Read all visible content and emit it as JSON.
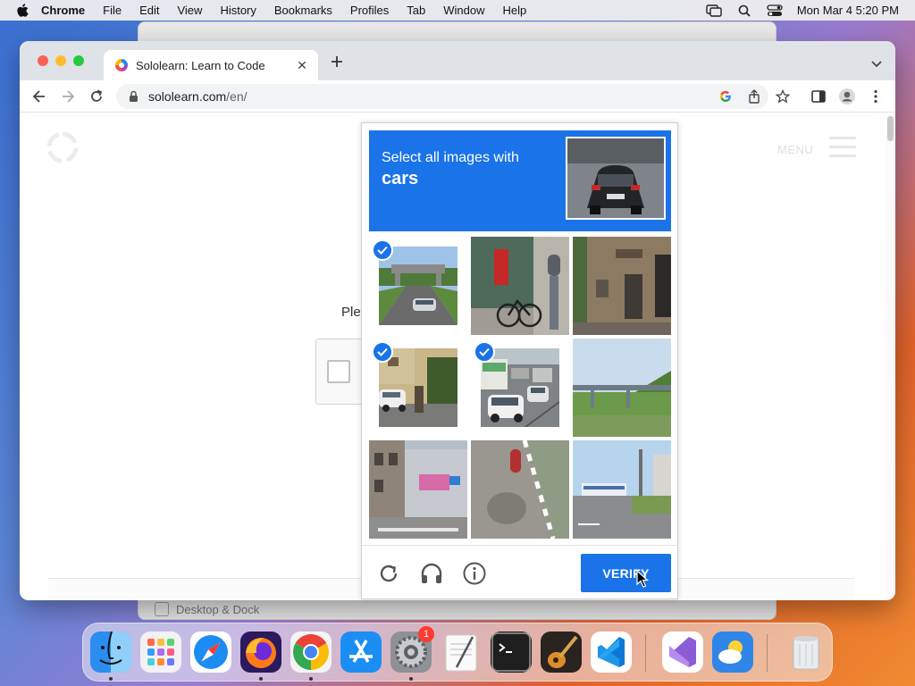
{
  "menubar": {
    "app_name": "Chrome",
    "items": [
      "File",
      "Edit",
      "View",
      "History",
      "Bookmarks",
      "Profiles",
      "Tab",
      "Window",
      "Help"
    ],
    "clock": "Mon Mar 4  5:20 PM"
  },
  "background_window": {
    "label": "Desktop & Dock"
  },
  "browser": {
    "tab_title": "Sololearn: Learn to Code",
    "url_host": "sololearn.com",
    "url_path": "/en/"
  },
  "page": {
    "partial_text": "Ple",
    "menu_label": "MENU"
  },
  "captcha": {
    "instruction": "Select all images with",
    "target": "cars",
    "verify_label": "VERIFY",
    "tiles": [
      {
        "selected": true
      },
      {
        "selected": false
      },
      {
        "selected": false
      },
      {
        "selected": true
      },
      {
        "selected": true
      },
      {
        "selected": false
      },
      {
        "selected": false
      },
      {
        "selected": false
      },
      {
        "selected": false
      }
    ]
  },
  "dock": {
    "apps": [
      "finder",
      "launchpad",
      "safari",
      "firefox",
      "chrome",
      "app-store",
      "system-settings",
      "textedit",
      "terminal",
      "garageband",
      "vscode",
      "visual-studio",
      "weather",
      "trash"
    ],
    "system_settings_badge": "1"
  },
  "colors": {
    "captcha_blue": "#1a73e8",
    "mac_red": "#fe5f57",
    "mac_yellow": "#febc2e",
    "mac_green": "#28c840"
  }
}
